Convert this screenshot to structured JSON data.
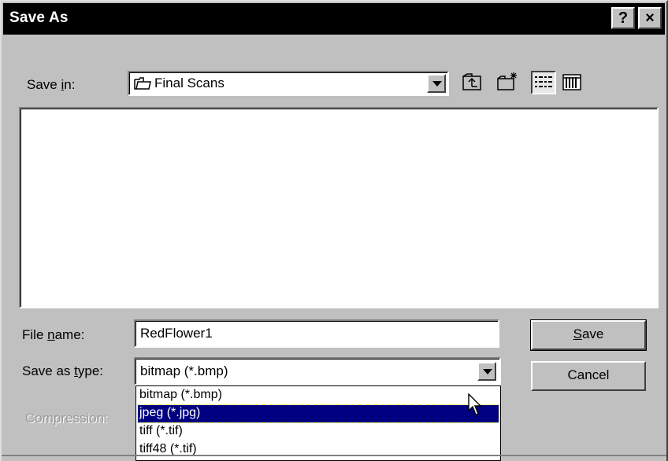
{
  "window": {
    "title": "Save As",
    "help_label": "?",
    "close_label": "×"
  },
  "save_in": {
    "label_pre": "Save ",
    "label_accel": "i",
    "label_post": "n:",
    "value": "Final Scans"
  },
  "toolbar": {
    "icons": [
      "up-folder-icon",
      "new-folder-icon",
      "list-view-icon",
      "details-view-icon"
    ]
  },
  "file_name": {
    "label_pre": "File ",
    "label_accel": "n",
    "label_post": "ame:",
    "value": "RedFlower1"
  },
  "save_as_type": {
    "label_pre": "Save as ",
    "label_accel": "t",
    "label_post": "ype:",
    "value": "bitmap (*.bmp)",
    "options": [
      "bitmap (*.bmp)",
      "jpeg (*.jpg)",
      "tiff (*.tif)",
      "tiff48 (*.tif)"
    ],
    "highlighted_index": 1
  },
  "compression": {
    "label": "Compression:"
  },
  "buttons": {
    "save_accel": "S",
    "save_rest": "ave",
    "cancel": "Cancel"
  },
  "colors": {
    "face": "#c0c0c0",
    "titlebar": "#000000",
    "highlight": "#000080"
  }
}
